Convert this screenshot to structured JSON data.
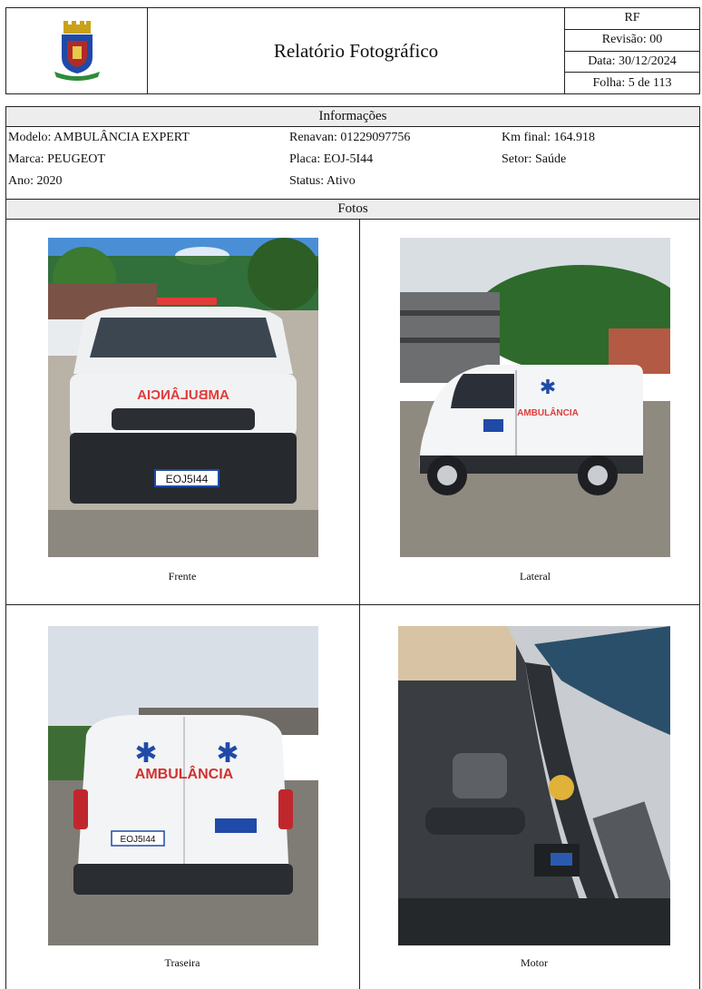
{
  "header": {
    "title": "Relatório Fotográfico",
    "code": "RF",
    "revision": "Revisão: 00",
    "date": "Data: 30/12/2024",
    "sheet": "Folha: 5 de 113"
  },
  "info": {
    "heading": "Informações",
    "model": "Modelo: AMBULÂNCIA EXPERT",
    "brand": "Marca: PEUGEOT",
    "year": "Ano: 2020",
    "renavan": "Renavan: 01229097756",
    "plate": "Placa: EOJ-5I44",
    "status": "Status: Ativo",
    "km": "Km final: 164.918",
    "sector": "Setor: Saúde"
  },
  "photos": {
    "heading": "Fotos",
    "items": [
      {
        "caption": "Frente"
      },
      {
        "caption": "Lateral"
      },
      {
        "caption": "Traseira"
      },
      {
        "caption": "Motor"
      }
    ],
    "vehicle_text": "AMBULÂNCIA",
    "plate_text": "EOJ5I44"
  }
}
